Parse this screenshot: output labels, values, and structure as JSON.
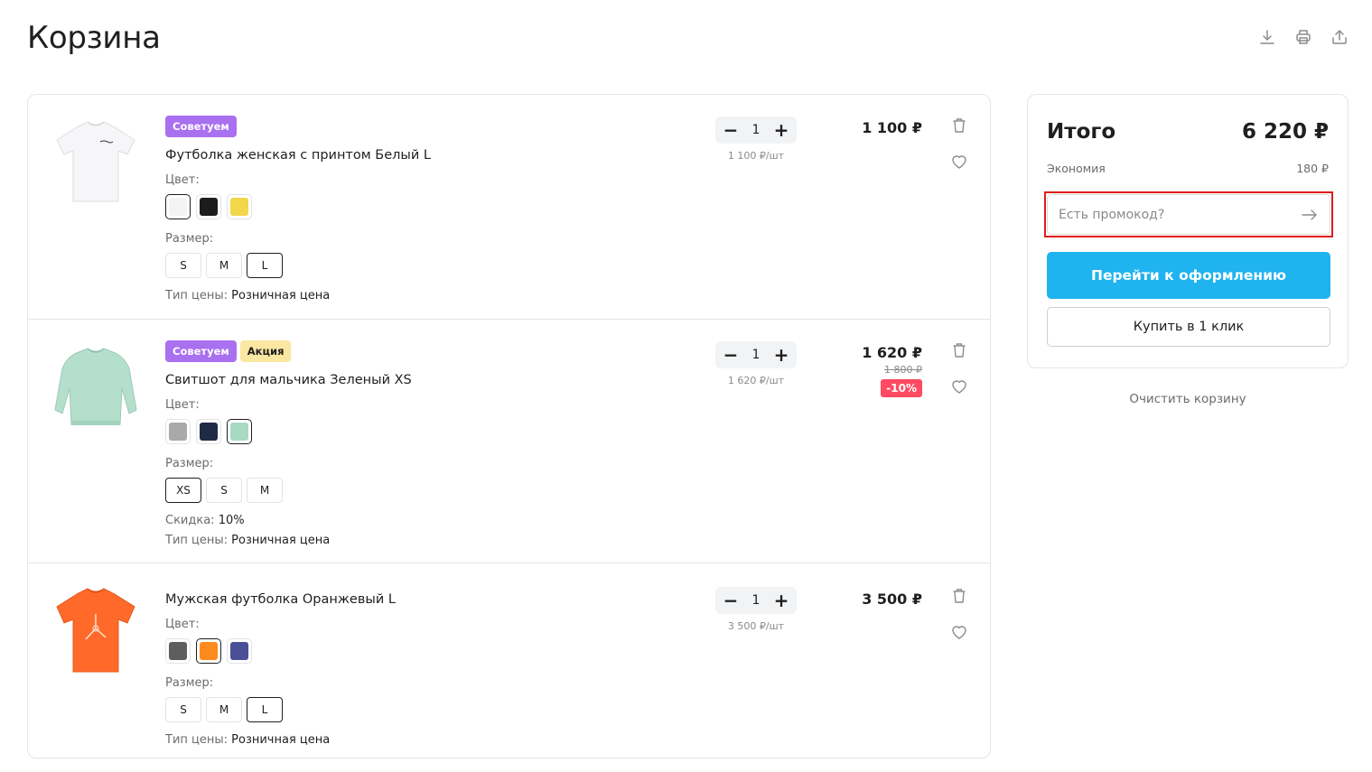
{
  "page": {
    "title": "Корзина"
  },
  "top_actions": [
    {
      "name": "download-icon"
    },
    {
      "name": "print-icon"
    },
    {
      "name": "share-icon"
    }
  ],
  "labels": {
    "color": "Цвет:",
    "size": "Размер:",
    "price_type": "Тип цены:",
    "discount": "Скидка:"
  },
  "items": [
    {
      "badges": [
        "Советуем"
      ],
      "name": "Футболка женская с принтом Белый L",
      "image": "white-tshirt",
      "colors": [
        {
          "hex": "#f4f4f6",
          "selected": true
        },
        {
          "hex": "#1c1c1c",
          "selected": false
        },
        {
          "hex": "#f2d74a",
          "selected": false
        }
      ],
      "sizes": [
        {
          "label": "S",
          "selected": false
        },
        {
          "label": "M",
          "selected": false
        },
        {
          "label": "L",
          "selected": true
        }
      ],
      "discount_value": "",
      "price_type_value": "Розничная цена",
      "quantity": "1",
      "unit_price": "1 100 ₽/шт",
      "price": "1 100 ₽",
      "old_price": "",
      "discount_badge": ""
    },
    {
      "badges": [
        "Советуем",
        "Акция"
      ],
      "name": "Свитшот для мальчика Зеленый XS",
      "image": "green-sweatshirt",
      "colors": [
        {
          "hex": "#a9a9a9",
          "selected": false
        },
        {
          "hex": "#1f2a44",
          "selected": false
        },
        {
          "hex": "#a8d9c4",
          "selected": true
        }
      ],
      "sizes": [
        {
          "label": "XS",
          "selected": true
        },
        {
          "label": "S",
          "selected": false
        },
        {
          "label": "M",
          "selected": false
        }
      ],
      "discount_value": "10%",
      "price_type_value": "Розничная цена",
      "quantity": "1",
      "unit_price": "1 620 ₽/шт",
      "price": "1 620 ₽",
      "old_price": "1 800 ₽",
      "discount_badge": "-10%"
    },
    {
      "badges": [],
      "name": "Мужская футболка Оранжевый L",
      "image": "orange-tshirt",
      "colors": [
        {
          "hex": "#5e5e5e",
          "selected": false
        },
        {
          "hex": "#ff8a1e",
          "selected": true
        },
        {
          "hex": "#4a5096",
          "selected": false
        }
      ],
      "sizes": [
        {
          "label": "S",
          "selected": false
        },
        {
          "label": "M",
          "selected": false
        },
        {
          "label": "L",
          "selected": true
        }
      ],
      "discount_value": "",
      "price_type_value": "Розничная цена",
      "quantity": "1",
      "unit_price": "3 500 ₽/шт",
      "price": "3 500 ₽",
      "old_price": "",
      "discount_badge": ""
    }
  ],
  "summary": {
    "total_label": "Итого",
    "total_value": "6 220 ₽",
    "saving_label": "Экономия",
    "saving_value": "180 ₽",
    "promo_placeholder": "Есть промокод?",
    "checkout_label": "Перейти к оформлению",
    "one_click_label": "Купить в 1 клик",
    "clear_cart_label": "Очистить корзину"
  },
  "colors": {
    "accent": "#1fb3f0",
    "badge_recommend": "#a970f0",
    "badge_promo": "#fbe7a1",
    "discount": "#ff4a62",
    "highlight": "#e31b1b"
  }
}
